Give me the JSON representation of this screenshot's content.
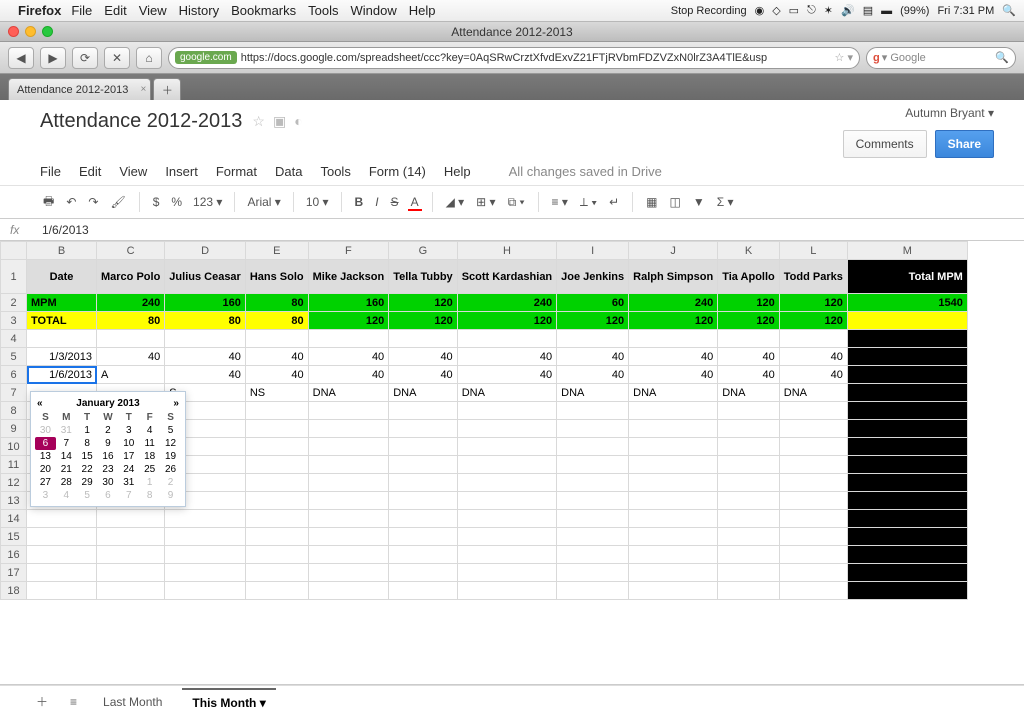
{
  "mac": {
    "app": "Firefox",
    "menus": [
      "File",
      "Edit",
      "View",
      "History",
      "Bookmarks",
      "Tools",
      "Window",
      "Help"
    ],
    "stop": "Stop Recording",
    "battery": "(99%)",
    "dayTime": "Fri 7:31 PM"
  },
  "window": {
    "title": "Attendance 2012-2013"
  },
  "nav": {
    "host": "google.com",
    "url": "https://docs.google.com/spreadsheet/ccc?key=0AqSRwCrztXfvdExvZ21FTjRVbmFDZVZxN0lrZ3A4TlE&usp",
    "searchPlaceholder": "Google"
  },
  "tabs": {
    "main": "Attendance 2012-2013"
  },
  "docs": {
    "user": "Autumn Bryant ▾",
    "title": "Attendance 2012-2013",
    "menus": [
      "File",
      "Edit",
      "View",
      "Insert",
      "Format",
      "Data",
      "Tools",
      "Form (14)",
      "Help"
    ],
    "saved": "All changes saved in Drive",
    "comments": "Comments",
    "share": "Share"
  },
  "toolbar": {
    "font": "Arial",
    "size": "10",
    "fmt": "123 ▾",
    "currency": "$",
    "percent": "%"
  },
  "fx": {
    "value": "1/6/2013"
  },
  "sheet": {
    "colLetters": [
      "B",
      "C",
      "D",
      "E",
      "F",
      "G",
      "H",
      "I",
      "J",
      "K",
      "L",
      "M"
    ],
    "headerRow": [
      "Date",
      "Marco Polo",
      "Julius Ceasar",
      "Hans Solo",
      "Mike Jackson",
      "Tella Tubby",
      "Scott Kardashian",
      "Joe Jenkins",
      "Ralph Simpson",
      "Tia Apollo",
      "Todd Parks",
      "Total MPM"
    ],
    "mpm": [
      "MPM",
      "240",
      "160",
      "80",
      "160",
      "120",
      "240",
      "60",
      "240",
      "120",
      "120",
      "1540"
    ],
    "totalRow": [
      "TOTAL",
      "80",
      "80",
      "80",
      "120",
      "120",
      "120",
      "120",
      "120",
      "120",
      "120",
      ""
    ],
    "totalGreenIdx": [
      4,
      5,
      6,
      7,
      8,
      9,
      10
    ],
    "r5": [
      "1/3/2013",
      "40",
      "40",
      "40",
      "40",
      "40",
      "40",
      "40",
      "40",
      "40",
      "40",
      ""
    ],
    "r6": [
      "1/6/2013",
      "A",
      "40",
      "40",
      "40",
      "40",
      "40",
      "40",
      "40",
      "40",
      "40",
      ""
    ],
    "r7": [
      "",
      "",
      "S",
      "NS",
      "DNA",
      "DNA",
      "DNA",
      "DNA",
      "DNA",
      "DNA",
      "DNA",
      ""
    ],
    "emptyRows": [
      4,
      8,
      9,
      10,
      11,
      12,
      13,
      14,
      15,
      16,
      17,
      18
    ]
  },
  "datepicker": {
    "title": "January 2013",
    "dow": [
      "S",
      "M",
      "T",
      "W",
      "T",
      "F",
      "S"
    ],
    "weeks": [
      [
        {
          "d": "30",
          "m": 1
        },
        {
          "d": "31",
          "m": 1
        },
        {
          "d": "1"
        },
        {
          "d": "2"
        },
        {
          "d": "3"
        },
        {
          "d": "4"
        },
        {
          "d": "5"
        }
      ],
      [
        {
          "d": "6",
          "sel": 1
        },
        {
          "d": "7"
        },
        {
          "d": "8"
        },
        {
          "d": "9"
        },
        {
          "d": "10"
        },
        {
          "d": "11"
        },
        {
          "d": "12"
        }
      ],
      [
        {
          "d": "13"
        },
        {
          "d": "14"
        },
        {
          "d": "15"
        },
        {
          "d": "16"
        },
        {
          "d": "17"
        },
        {
          "d": "18"
        },
        {
          "d": "19"
        }
      ],
      [
        {
          "d": "20"
        },
        {
          "d": "21"
        },
        {
          "d": "22"
        },
        {
          "d": "23"
        },
        {
          "d": "24"
        },
        {
          "d": "25"
        },
        {
          "d": "26"
        }
      ],
      [
        {
          "d": "27"
        },
        {
          "d": "28"
        },
        {
          "d": "29"
        },
        {
          "d": "30"
        },
        {
          "d": "31"
        },
        {
          "d": "1",
          "m": 1
        },
        {
          "d": "2",
          "m": 1
        }
      ],
      [
        {
          "d": "3",
          "m": 1
        },
        {
          "d": "4",
          "m": 1
        },
        {
          "d": "5",
          "m": 1
        },
        {
          "d": "6",
          "m": 1
        },
        {
          "d": "7",
          "m": 1
        },
        {
          "d": "8",
          "m": 1
        },
        {
          "d": "9",
          "m": 1
        }
      ]
    ]
  },
  "sheetTabs": {
    "last": "Last Month",
    "this": "This Month ▾"
  }
}
